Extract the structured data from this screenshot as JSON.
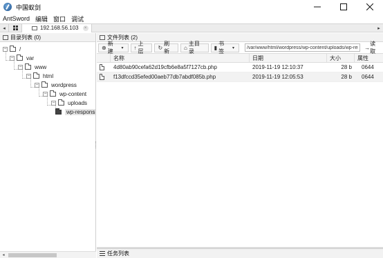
{
  "window": {
    "title": "中国蚁剑"
  },
  "menu": {
    "items": [
      "AntSword",
      "编辑",
      "窗口",
      "调试"
    ]
  },
  "tabs": {
    "host_tab": "192.168.56.103",
    "close_glyph": "×"
  },
  "left_panel": {
    "header": "目录列表 (0)",
    "tree": [
      {
        "label": "/",
        "toggle": "−"
      },
      {
        "label": "var",
        "toggle": "−"
      },
      {
        "label": "www",
        "toggle": "−"
      },
      {
        "label": "html",
        "toggle": "−"
      },
      {
        "label": "wordpress",
        "toggle": "−"
      },
      {
        "label": "wp-content",
        "toggle": "−"
      },
      {
        "label": "uploads",
        "toggle": "−"
      },
      {
        "label": "wp-responsive",
        "toggle": ""
      }
    ]
  },
  "right_panel": {
    "header": "文件列表 (2)",
    "toolbar": {
      "new_label": "新建",
      "up_label": "上层",
      "refresh_label": "刷新",
      "home_label": "主目录",
      "bookmark_label": "书签",
      "path_value": "/var/www/html/wordpress/wp-content/uploads/wp-resp",
      "read_label": "读取"
    },
    "columns": [
      "名称",
      "日期",
      "大小",
      "属性"
    ],
    "files": [
      {
        "name": "4d80ab90cefa62d19cfb6e8a5f7127cb.php",
        "date": "2019-11-19 12:10:37",
        "size": "28 b",
        "perm": "0644"
      },
      {
        "name": "f13dfccd35efed00aeb77db7abdf085b.php",
        "date": "2019-11-19 12:05:53",
        "size": "28 b",
        "perm": "0644"
      }
    ]
  },
  "task_panel": {
    "header": "任务列表"
  },
  "icons": {
    "app": "antsword-logo-icon",
    "minimize": "minimize-icon",
    "maximize": "maximize-icon",
    "close": "close-icon"
  }
}
